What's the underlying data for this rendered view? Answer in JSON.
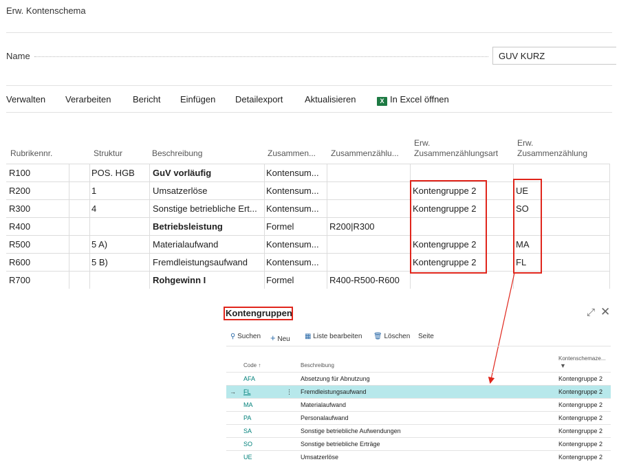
{
  "page": {
    "title": "Erw. Kontenschema",
    "name_label": "Name",
    "name_value": "GUV KURZ"
  },
  "actions": [
    "Verwalten",
    "Verarbeiten",
    "Bericht",
    "Einfügen",
    "Detailexport",
    "Aktualisieren",
    "In Excel öffnen"
  ],
  "excel_icon_text": "X",
  "grid": {
    "headers": {
      "rubrik": "Rubrikennr.",
      "struktur": "Struktur",
      "beschreibung": "Beschreibung",
      "zus1": "Zusammen...",
      "zus2": "Zusammenzählu...",
      "erw_art_1": "Erw.",
      "erw_art_2": "Zusammenzählungsart",
      "erw_zus_1": "Erw.",
      "erw_zus_2": "Zusammenzählung"
    },
    "rows": [
      {
        "rubrik": "R100",
        "struktur": "POS. HGB",
        "beschreibung": "GuV vorläufig",
        "bold": true,
        "zus1": "Kontensum...",
        "zus2": "",
        "erw_art": "",
        "erw_zus": ""
      },
      {
        "rubrik": "R200",
        "struktur": "1",
        "beschreibung": "Umsatzerlöse",
        "bold": false,
        "zus1": "Kontensum...",
        "zus2": "",
        "erw_art": "Kontengruppe 2",
        "erw_zus": "UE"
      },
      {
        "rubrik": "R300",
        "struktur": "4",
        "beschreibung": "Sonstige betriebliche Ert...",
        "bold": false,
        "zus1": "Kontensum...",
        "zus2": "",
        "erw_art": "Kontengruppe 2",
        "erw_zus": "SO"
      },
      {
        "rubrik": "R400",
        "struktur": "",
        "beschreibung": "Betriebsleistung",
        "bold": true,
        "zus1": "Formel",
        "zus2": "R200|R300",
        "erw_art": "",
        "erw_zus": ""
      },
      {
        "rubrik": "R500",
        "struktur": "5 A)",
        "beschreibung": "Materialaufwand",
        "bold": false,
        "zus1": "Kontensum...",
        "zus2": "",
        "erw_art": "Kontengruppe 2",
        "erw_zus": "MA"
      },
      {
        "rubrik": "R600",
        "struktur": "5 B)",
        "beschreibung": "Fremdleistungsaufwand",
        "bold": false,
        "zus1": "Kontensum...",
        "zus2": "",
        "erw_art": "Kontengruppe 2",
        "erw_zus": "FL"
      },
      {
        "rubrik": "R700",
        "struktur": "",
        "beschreibung": "Rohgewinn I",
        "bold": true,
        "zus1": "Formel",
        "zus2": "R400-R500-R600",
        "erw_art": "",
        "erw_zus": ""
      }
    ]
  },
  "subpage": {
    "title": "Kontengruppen",
    "expand_icon": "expand-icon",
    "close_icon": "close-icon",
    "toolbar": [
      "Suchen",
      "Neu",
      "Liste bearbeiten",
      "Löschen",
      "Seite"
    ],
    "headers": {
      "code": "Code ↑",
      "beschreibung": "Beschreibung",
      "kontenschema": "Kontenschemaze..."
    },
    "rows": [
      {
        "code": "AFA",
        "beschreibung": "Absetzung für Abnutzung",
        "kontenschema": "Kontengruppe 2",
        "selected": false
      },
      {
        "code": "FL",
        "beschreibung": "Fremdleistungsaufwand",
        "kontenschema": "Kontengruppe 2",
        "selected": true
      },
      {
        "code": "MA",
        "beschreibung": "Materialaufwand",
        "kontenschema": "Kontengruppe 2",
        "selected": false
      },
      {
        "code": "PA",
        "beschreibung": "Personalaufwand",
        "kontenschema": "Kontengruppe 2",
        "selected": false
      },
      {
        "code": "SA",
        "beschreibung": "Sonstige betriebliche Aufwendungen",
        "kontenschema": "Kontengruppe 2",
        "selected": false
      },
      {
        "code": "SO",
        "beschreibung": "Sonstige betriebliche Erträge",
        "kontenschema": "Kontengruppe 2",
        "selected": false
      },
      {
        "code": "UE",
        "beschreibung": "Umsatzerlöse",
        "kontenschema": "Kontengruppe 2",
        "selected": false
      }
    ]
  },
  "colors": {
    "highlight_red": "#e0251b",
    "selected_row": "#b7e8eb",
    "link_teal": "#00807a",
    "excel_green": "#1d7a43"
  }
}
